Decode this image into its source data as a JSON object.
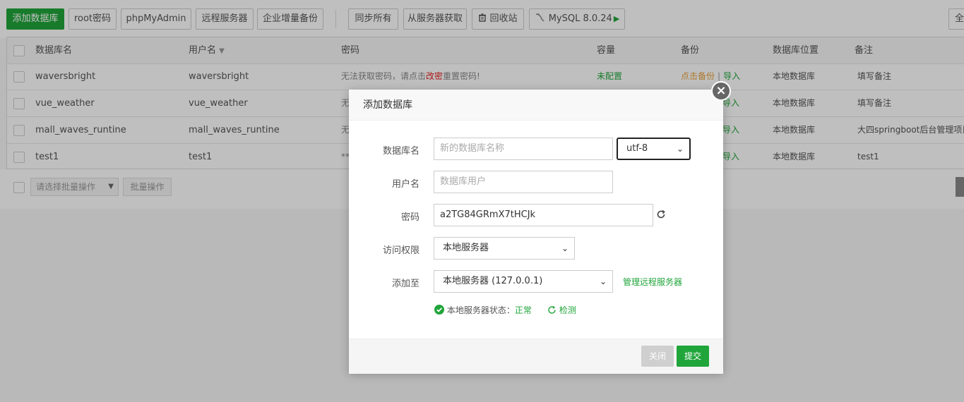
{
  "toolbar": {
    "add_db": "添加数据库",
    "root_pwd": "root密码",
    "phpmyadmin": "phpMyAdmin",
    "remote_server": "远程服务器",
    "enterprise_backup": "企业增量备份",
    "sync_all": "同步所有",
    "fetch_from_server": "从服务器获取",
    "recycle_bin": "回收站",
    "mysql_version": "MySQL 8.0.24",
    "right_cut": "全"
  },
  "table": {
    "headers": [
      "数据库名",
      "用户名",
      "密码",
      "容量",
      "备份",
      "数据库位置",
      "备注"
    ],
    "rows": [
      {
        "name": "waversbright",
        "user": "waversbright",
        "pwd_a": "无法获取密码，请点击",
        "pwd_link": "改密",
        "pwd_b": "重置密码!",
        "size": "未配置",
        "backup": "点击备份",
        "import": "导入",
        "location": "本地数据库",
        "note": "填写备注"
      },
      {
        "name": "vue_weather",
        "user": "vue_weather",
        "pwd_a": "无",
        "size": "",
        "backup": "",
        "import": "导入",
        "location": "本地数据库",
        "note": "填写备注"
      },
      {
        "name": "mall_waves_runtine",
        "user": "mall_waves_runtine",
        "pwd_a": "无",
        "size": "",
        "backup": "",
        "import": "导入",
        "location": "本地数据库",
        "note": "大四springboot后台管理项目"
      },
      {
        "name": "test1",
        "user": "test1",
        "pwd_a": "**",
        "size": "",
        "backup": "",
        "import": "导入",
        "location": "本地数据库",
        "note": "test1"
      }
    ]
  },
  "batch": {
    "select_placeholder": "请选择批量操作",
    "batch_button": "批量操作"
  },
  "modal": {
    "title": "添加数据库",
    "labels": {
      "db_name": "数据库名",
      "username": "用户名",
      "password": "密码",
      "access": "访问权限",
      "add_to": "添加至"
    },
    "db_name_placeholder": "新的数据库名称",
    "charset": "utf-8",
    "username_placeholder": "数据库用户",
    "password_value": "a2TG84GRmX7tHCJk",
    "access_value": "本地服务器",
    "add_to_value": "本地服务器 (127.0.0.1)",
    "manage_remote": "管理远程服务器",
    "server_status_label": "本地服务器状态：",
    "server_status_value": "正常",
    "check": "检测",
    "cancel": "关闭",
    "submit": "提交"
  },
  "colors": {
    "accent": "#20a53a",
    "warning": "#e6a23c",
    "danger": "#e21f1f"
  },
  "icons": [
    "trash-icon",
    "mysql-icon",
    "play-icon",
    "sort-caret-icon",
    "refresh-icon",
    "check-circle-icon",
    "detect-icon",
    "close-icon",
    "chevron-down-icon"
  ]
}
